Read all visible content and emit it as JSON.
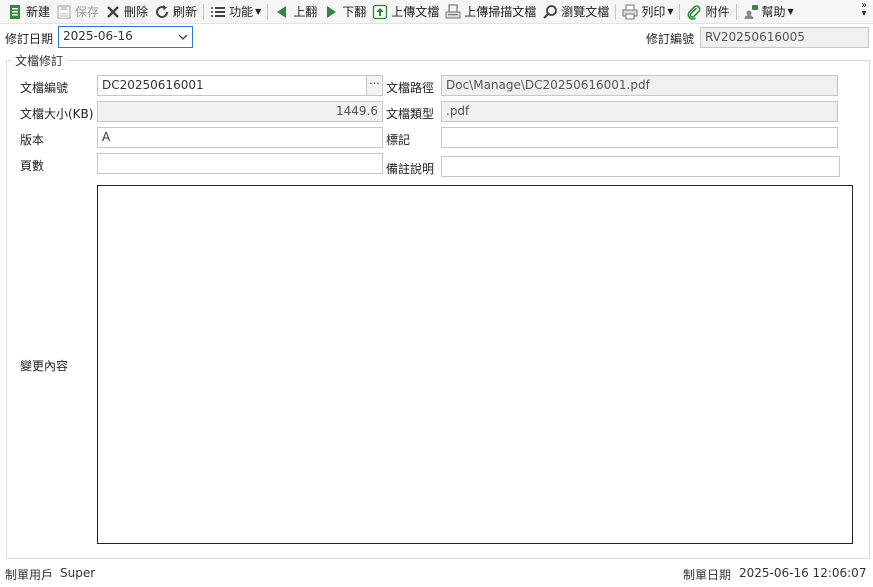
{
  "toolbar": {
    "new": "新建",
    "save": "保存",
    "delete": "刪除",
    "refresh": "刷新",
    "functions": "功能",
    "prev": "上翻",
    "next": "下翻",
    "upload": "上傳文檔",
    "upload_scan": "上傳掃描文檔",
    "browse": "瀏覽文檔",
    "print": "列印",
    "attach": "附件",
    "help": "幫助"
  },
  "header": {
    "revision_date_label": "修訂日期",
    "revision_date": "2025-06-16",
    "revision_no_label": "修訂編號",
    "revision_no": "RV20250616005"
  },
  "group": {
    "title": "文檔修訂",
    "doc_no_label": "文檔編號",
    "doc_no": "DC20250616001",
    "doc_path_label": "文檔路徑",
    "doc_path": "Doc\\Manage\\DC20250616001.pdf",
    "doc_size_label": "文檔大小(KB)",
    "doc_size": "1449.6",
    "doc_type_label": "文檔類型",
    "doc_type": ".pdf",
    "version_label": "版本",
    "version": "A",
    "mark_label": "標記",
    "mark": "",
    "pages_label": "頁數",
    "pages": "",
    "remark_label": "備註說明",
    "remark": "",
    "change_label": "變更內容",
    "change": ""
  },
  "footer": {
    "creator_label": "制單用戶",
    "creator": "Super",
    "created_label": "制單日期",
    "created": "2025-06-16 12:06:07"
  },
  "colors": {
    "accent": "#2a7ad2",
    "green": "#2e8b3e"
  }
}
